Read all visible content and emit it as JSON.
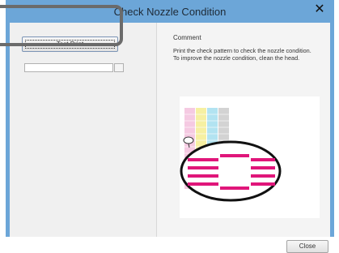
{
  "window": {
    "title": "Check Nozzle Condition",
    "close_glyph": "✕"
  },
  "left": {
    "test_print_label": "Test Print",
    "mode_value": "",
    "mode_button": ""
  },
  "right": {
    "comment_label": "Comment",
    "comment_line1": "Print the check pattern to check the nozzle condition.",
    "comment_line2": "To improve the nozzle condition, clean the head."
  },
  "footer": {
    "close_label": "Close"
  },
  "colors": {
    "frame": "#6ca6d8",
    "magenta": "#e0167a",
    "cyan": "#7fd0e8",
    "yellow": "#f2ea7a",
    "pink": "#f2b8d8",
    "gray": "#c8c8c8"
  }
}
